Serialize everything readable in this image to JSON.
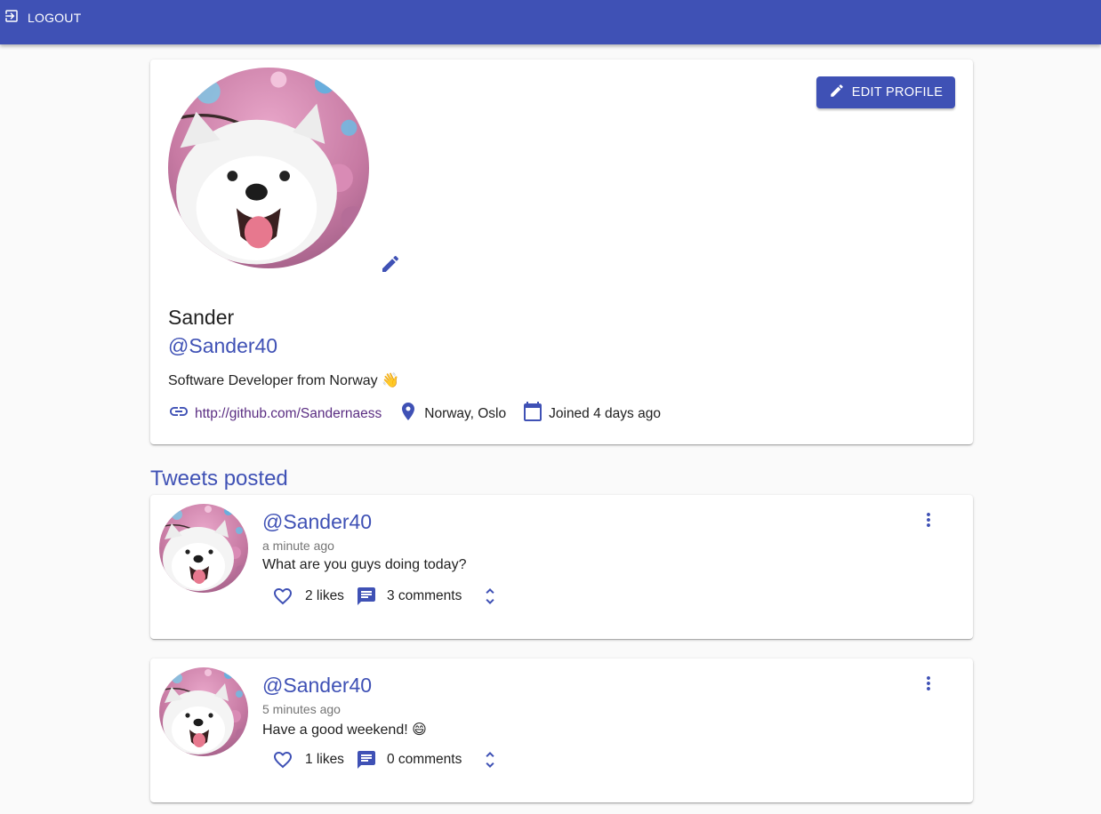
{
  "appbar": {
    "logout_label": "LOGOUT",
    "color": "#3f51b5"
  },
  "profile": {
    "edit_button_label": "EDIT PROFILE",
    "name": "Sander",
    "handle": "@Sander40",
    "bio": "Software Developer from Norway",
    "bio_emoji": "👋",
    "website": "http://github.com/Sandernaess",
    "location": "Norway, Oslo",
    "joined": "Joined 4 days ago",
    "icons": [
      "edit-icon",
      "link-icon",
      "location-pin-icon",
      "calendar-icon"
    ]
  },
  "tweets_section": {
    "title": "Tweets posted"
  },
  "tweets": [
    {
      "handle": "@Sander40",
      "time": "a minute ago",
      "text": "What are you guys doing today?",
      "emoji": "",
      "likes": "2 likes",
      "comments": "3 comments"
    },
    {
      "handle": "@Sander40",
      "time": "5 minutes ago",
      "text": "Have a good weekend!",
      "emoji": "😄",
      "likes": "1 likes",
      "comments": "0 comments"
    }
  ],
  "colors": {
    "primary": "#3f51b5",
    "link": "#5a2d82",
    "muted": "#757575"
  }
}
